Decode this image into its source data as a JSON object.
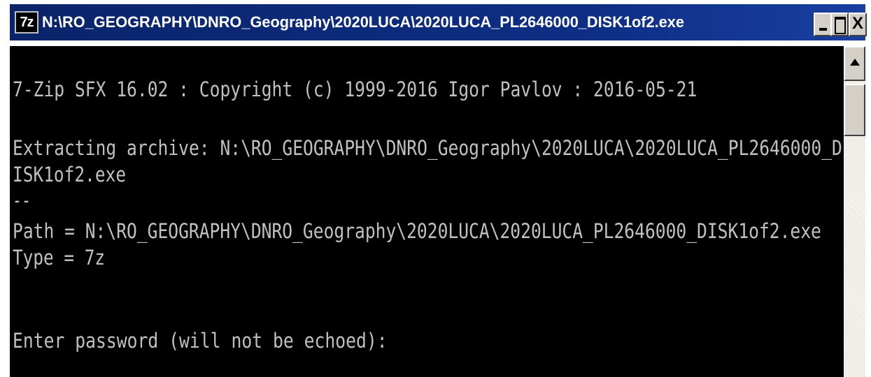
{
  "window": {
    "icon_text": "7z",
    "title": "N:\\RO_GEOGRAPHY\\DNRO_Geography\\2020LUCA\\2020LUCA_PL2646000_DISK1of2.exe",
    "buttons": {
      "minimize_icon": "minimize-icon",
      "maximize_icon": "maximize-icon",
      "close_label": "X"
    }
  },
  "console": {
    "text_color": "#c0c0c0",
    "background": "#000000",
    "lines": [
      "7-Zip SFX 16.02 : Copyright (c) 1999-2016 Igor Pavlov : 2016-05-21",
      "Extracting archive: N:\\RO_GEOGRAPHY\\DNRO_Geography\\2020LUCA\\2020LUCA_PL2646000_D",
      "ISK1of2.exe",
      "--",
      "Path = N:\\RO_GEOGRAPHY\\DNRO_Geography\\2020LUCA\\2020LUCA_PL2646000_DISK1of2.exe",
      "Type = 7z",
      "Enter password (will not be echoed):"
    ]
  },
  "colors": {
    "titlebar": "#0a246a",
    "chrome": "#d4d0c8"
  }
}
